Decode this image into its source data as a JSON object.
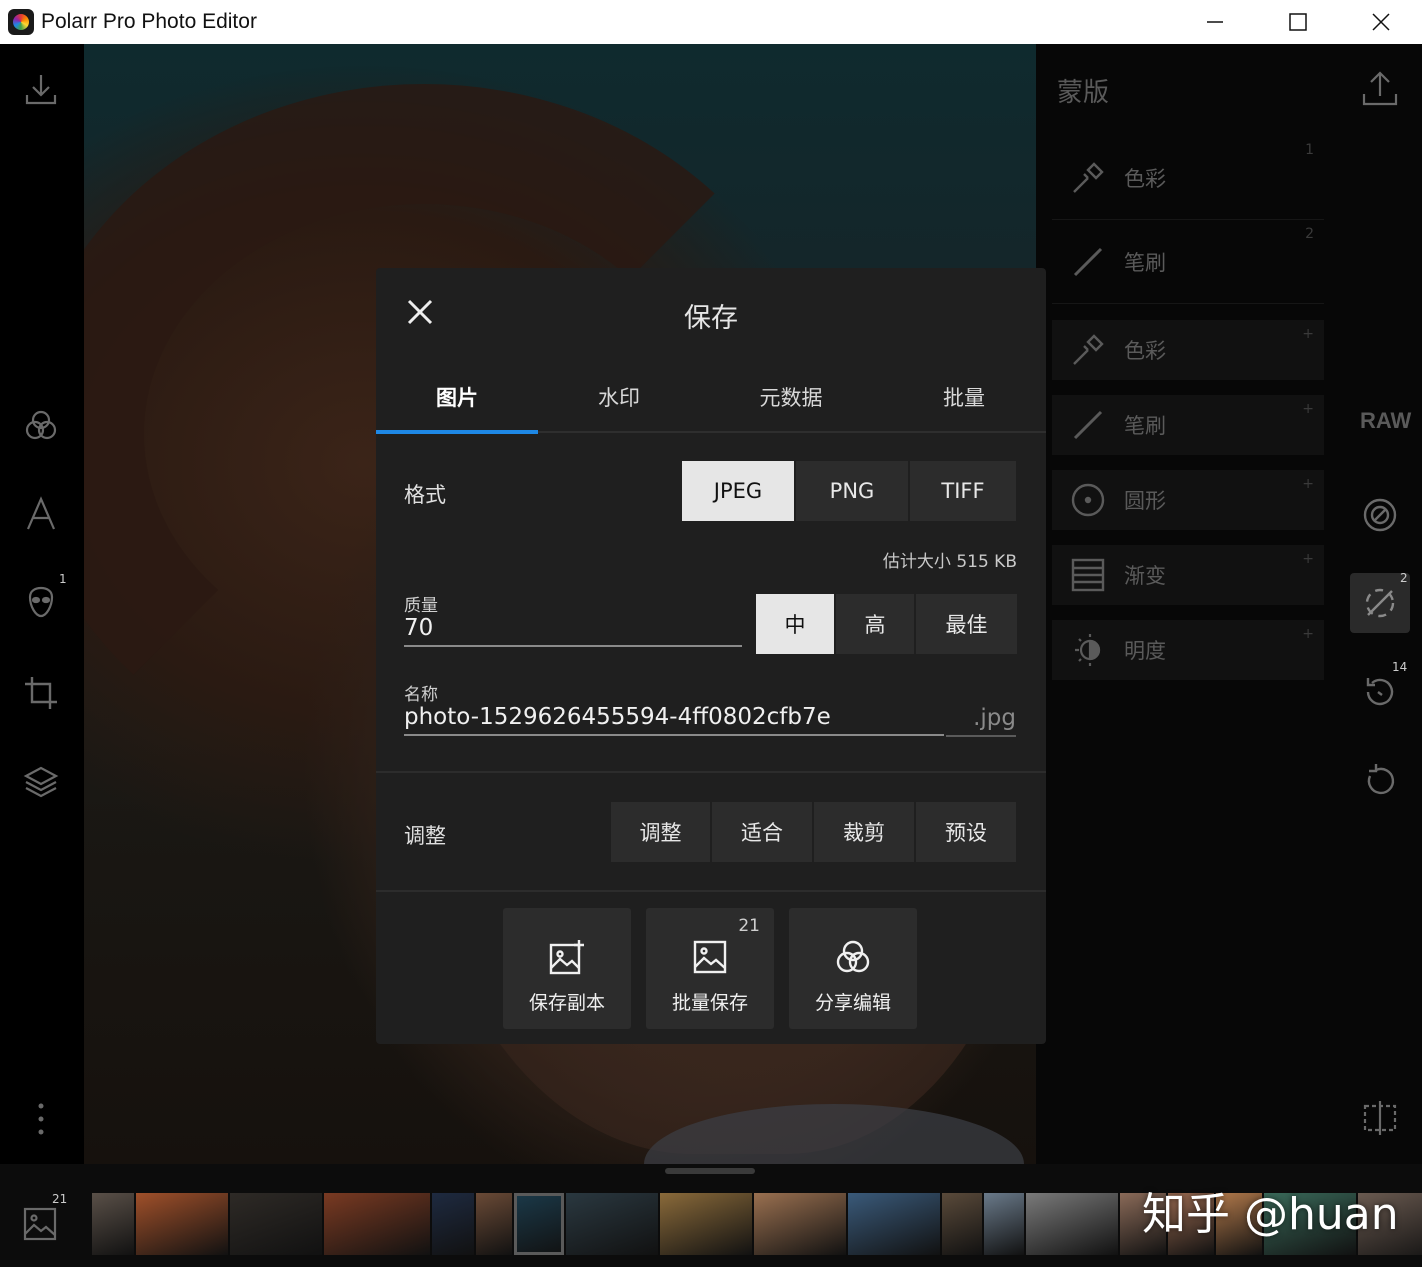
{
  "window": {
    "title": "Polarr Pro Photo Editor",
    "controls": [
      "minimize-icon",
      "maximize-icon",
      "close-icon"
    ]
  },
  "left_toolbar": {
    "items": [
      {
        "icon": "download-icon"
      },
      {
        "icon": "filters-icon"
      },
      {
        "icon": "text-icon"
      },
      {
        "icon": "face-icon",
        "badge": "1"
      },
      {
        "icon": "crop-icon"
      },
      {
        "icon": "layers-icon"
      },
      {
        "icon": "more-icon"
      }
    ]
  },
  "right_panel": {
    "title": "蒙版",
    "items": [
      {
        "icon": "eyedropper-icon",
        "label": "色彩",
        "num": "1"
      },
      {
        "icon": "brush-icon",
        "label": "笔刷",
        "num": "2"
      },
      {
        "icon": "eyedropper-icon",
        "label": "色彩",
        "num": "+"
      },
      {
        "icon": "brush-icon",
        "label": "笔刷",
        "num": "+"
      },
      {
        "icon": "circle-icon",
        "label": "圆形",
        "num": "+"
      },
      {
        "icon": "gradient-icon",
        "label": "渐变",
        "num": "+"
      },
      {
        "icon": "brightness-icon",
        "label": "明度",
        "num": "+"
      }
    ],
    "side": {
      "raw_label": "RAW",
      "mask_badge": "2",
      "history_badge": "14"
    }
  },
  "dialog": {
    "title": "保存",
    "tabs": [
      "图片",
      "水印",
      "元数据",
      "批量"
    ],
    "active_tab": "图片",
    "format": {
      "label": "格式",
      "options": [
        "JPEG",
        "PNG",
        "TIFF"
      ],
      "selected": "JPEG"
    },
    "estimated_size": "估计大小 515 KB",
    "quality": {
      "label": "质量",
      "value": "70",
      "presets": [
        "中",
        "高",
        "最佳"
      ],
      "selected": "中"
    },
    "name": {
      "label": "名称",
      "value": "photo-1529626455594-4ff0802cfb7e",
      "extension": ".jpg"
    },
    "resize": {
      "label": "调整",
      "options": [
        "调整",
        "适合",
        "裁剪",
        "预设"
      ]
    },
    "actions": [
      {
        "icon": "save-copy-icon",
        "label": "保存副本"
      },
      {
        "icon": "batch-save-icon",
        "label": "批量保存",
        "badge": "21"
      },
      {
        "icon": "share-edit-icon",
        "label": "分享编辑"
      }
    ]
  },
  "filmstrip": {
    "count_badge": "21",
    "thumb_colors": [
      "#5a5048",
      "#a0502a",
      "#2e2a26",
      "#7a3a22",
      "#1e2a40",
      "#6a4a36",
      "#1b3a4a",
      "#2a3840",
      "#8a6a3a",
      "#9a7050",
      "#3a5a7a",
      "#5a4a3a",
      "#6a7a8a",
      "#7a7a7a",
      "#8a6a58",
      "#9a6a50",
      "#b0784a",
      "#3a6a5a",
      "#6a5a50",
      "#4a4a4a"
    ]
  },
  "watermark": "知乎 @huan"
}
